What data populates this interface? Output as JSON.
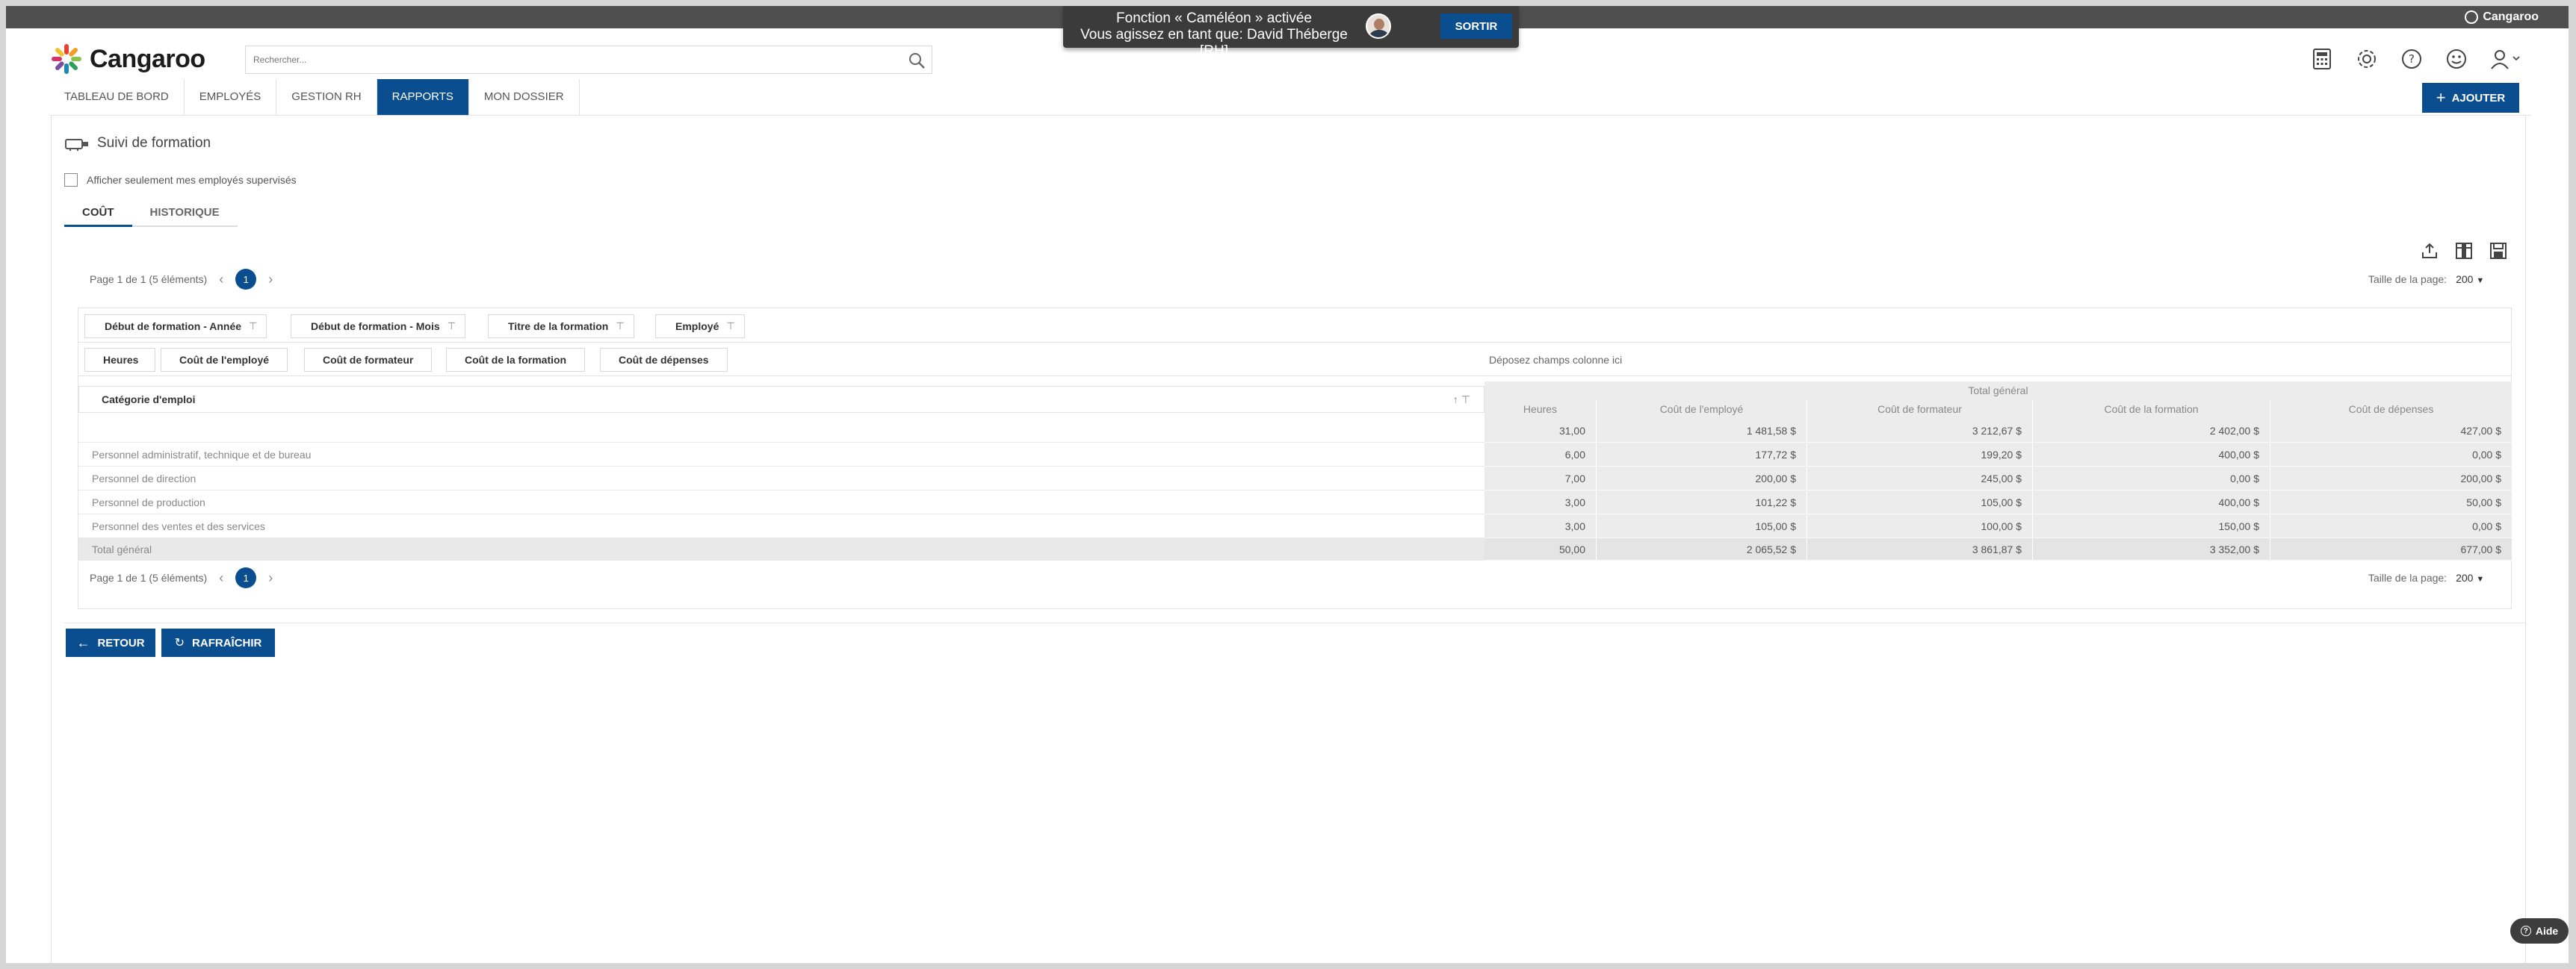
{
  "topbar": {
    "brand": "Cangaroo"
  },
  "chameleon": {
    "line1": "Fonction « Caméléon » activée",
    "line2": "Vous agissez en tant que: David Théberge [RH]",
    "exit_label": "SORTIR"
  },
  "header": {
    "logo_text": "Cangaroo",
    "search_placeholder": "Rechercher...",
    "icons": [
      "calculator-icon",
      "gear-icon",
      "help-icon",
      "smiley-icon",
      "user-icon"
    ]
  },
  "nav": {
    "items": [
      "TABLEAU DE BORD",
      "EMPLOYÉS",
      "GESTION RH",
      "RAPPORTS",
      "MON DOSSIER"
    ],
    "active": "RAPPORTS",
    "add_label": "AJOUTER"
  },
  "page": {
    "title": "Suivi de formation",
    "supervised_label": "Afficher seulement mes employés supervisés",
    "tabs": [
      "COÛT",
      "HISTORIQUE"
    ]
  },
  "pager": {
    "info": "Page 1 de 1 (5 éléments)",
    "current": "1",
    "pagesize_label": "Taille de la page:",
    "pagesize_value": "200"
  },
  "pivot": {
    "filter_fields": [
      "Début de formation - Année",
      "Début de formation - Mois",
      "Titre de la formation",
      "Employé"
    ],
    "data_fields": [
      "Heures",
      "Coût de l'employé",
      "Coût de formateur",
      "Coût de la formation",
      "Coût de dépenses"
    ],
    "drop_column_text": "Déposez champs colonne ici",
    "row_field": "Catégorie d'emploi",
    "grand_total_header": "Total général",
    "columns": [
      "Heures",
      "Coût de l'employé",
      "Coût de formateur",
      "Coût de la formation",
      "Coût de dépenses"
    ],
    "rows": [
      {
        "label": "",
        "values": [
          "31,00",
          "1 481,58 $",
          "3 212,67 $",
          "2 402,00 $",
          "427,00 $"
        ]
      },
      {
        "label": "Personnel administratif, technique et de bureau",
        "values": [
          "6,00",
          "177,72 $",
          "199,20 $",
          "400,00 $",
          "0,00 $"
        ]
      },
      {
        "label": "Personnel de direction",
        "values": [
          "7,00",
          "200,00 $",
          "245,00 $",
          "0,00 $",
          "200,00 $"
        ]
      },
      {
        "label": "Personnel de production",
        "values": [
          "3,00",
          "101,22 $",
          "105,00 $",
          "400,00 $",
          "50,00 $"
        ]
      },
      {
        "label": "Personnel des ventes et des services",
        "values": [
          "3,00",
          "105,00 $",
          "100,00 $",
          "150,00 $",
          "0,00 $"
        ]
      }
    ],
    "total": {
      "label": "Total général",
      "values": [
        "50,00",
        "2 065,52 $",
        "3 861,87 $",
        "3 352,00 $",
        "677,00 $"
      ]
    }
  },
  "actions": {
    "back": "RETOUR",
    "refresh": "RAFRAÎCHIR"
  },
  "help_label": "Aide"
}
